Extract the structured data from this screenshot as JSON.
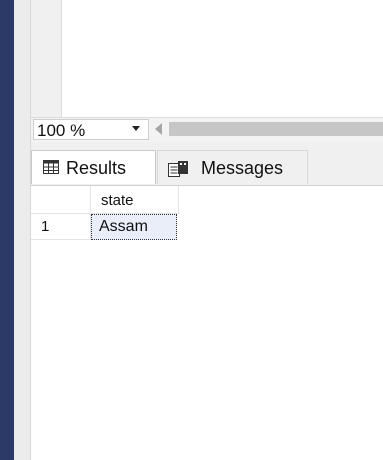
{
  "zoom": {
    "value": "100 %"
  },
  "tabs": [
    {
      "label": "Results",
      "icon": "grid-icon",
      "active": true
    },
    {
      "label": "Messages",
      "icon": "messages-icon",
      "active": false
    }
  ],
  "grid": {
    "columns": [
      "state"
    ],
    "rows": [
      {
        "row_number": "1",
        "cells": [
          "Assam"
        ]
      }
    ],
    "selected_cell": "Assam"
  },
  "colors": {
    "left_bar": "#2b3a67",
    "selected_cell_bg": "#e9eef8",
    "scrollbar": "#c6c6c6"
  }
}
